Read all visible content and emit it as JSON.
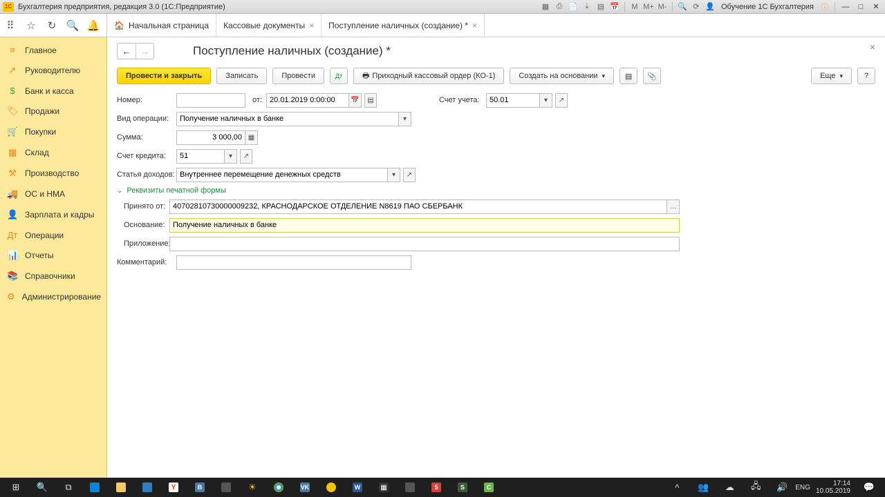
{
  "titlebar": {
    "app_title": "Бухгалтерия предприятия, редакция 3.0  (1С:Предприятие)",
    "user_label": "Обучение 1С Бухгалтерия",
    "logo": "1C"
  },
  "tabs": {
    "home": "Начальная страница",
    "t1": "Кассовые документы",
    "t2": "Поступление наличных (создание) *"
  },
  "sidebar": {
    "items": [
      {
        "icon": "≡",
        "label": "Главное"
      },
      {
        "icon": "↗",
        "label": "Руководителю"
      },
      {
        "icon": "$",
        "label": "Банк и касса"
      },
      {
        "icon": "🏷",
        "label": "Продажи"
      },
      {
        "icon": "🛒",
        "label": "Покупки"
      },
      {
        "icon": "▦",
        "label": "Склад"
      },
      {
        "icon": "⚒",
        "label": "Производство"
      },
      {
        "icon": "🚚",
        "label": "ОС и НМА"
      },
      {
        "icon": "👤",
        "label": "Зарплата и кадры"
      },
      {
        "icon": "Дт",
        "label": "Операции"
      },
      {
        "icon": "📊",
        "label": "Отчеты"
      },
      {
        "icon": "📚",
        "label": "Справочники"
      },
      {
        "icon": "⚙",
        "label": "Администрирование"
      }
    ]
  },
  "page": {
    "title": "Поступление наличных (создание) *"
  },
  "actions": {
    "post_close": "Провести и закрыть",
    "write": "Записать",
    "post": "Провести",
    "pko": "Приходный кассовый ордер (КО-1)",
    "create_based": "Создать на основании",
    "more": "Еще",
    "help": "?"
  },
  "form": {
    "number_label": "Номер:",
    "number_value": "",
    "from_label": "от:",
    "date_value": "20.01.2019 0:00:00",
    "account_label": "Счет учета:",
    "account_value": "50.01",
    "optype_label": "Вид операции:",
    "optype_value": "Получение наличных в банке",
    "sum_label": "Сумма:",
    "sum_value": "3 000,00",
    "credit_label": "Счет кредита:",
    "credit_value": "51",
    "income_label": "Статья доходов:",
    "income_value": "Внутреннее перемещение денежных средств",
    "section": "Реквизиты печатной формы",
    "received_label": "Принято от:",
    "received_value": "40702810730000009232, КРАСНОДАРСКОЕ ОТДЕЛЕНИЕ N8619 ПАО СБЕРБАНК",
    "basis_label": "Основание:",
    "basis_value": "Получение наличных в банке",
    "attach_label": "Приложение:",
    "attach_value": "",
    "comment_label": "Комментарий:",
    "comment_value": ""
  },
  "taskbar": {
    "time": "17:14",
    "date": "10.05.2019",
    "lang": "ENG"
  }
}
